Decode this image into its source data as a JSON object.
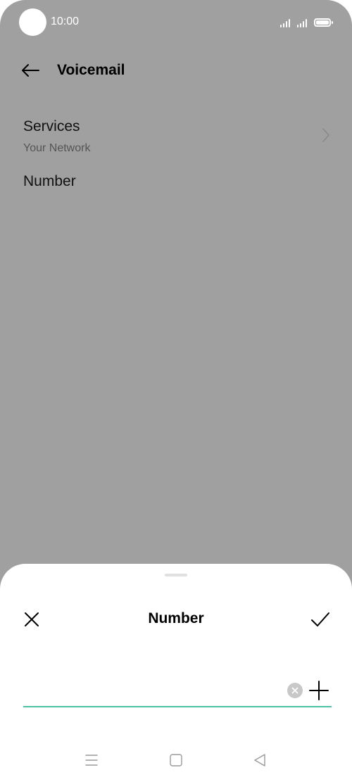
{
  "status_bar": {
    "time": "10:00",
    "icons": [
      "signal-icon",
      "signal-icon",
      "battery-icon"
    ]
  },
  "app_bar": {
    "back_icon": "arrow-left-icon",
    "title": "Voicemail"
  },
  "settings": {
    "items": [
      {
        "title": "Services",
        "subtitle": "Your Network",
        "icon": "chevron-right-icon"
      },
      {
        "title": "Number"
      }
    ]
  },
  "sheet": {
    "title": "Number",
    "close_icon": "close-icon",
    "confirm_icon": "checkmark-icon",
    "input": {
      "value": "",
      "placeholder": ""
    },
    "clear_icon": "clear-circle-icon",
    "add_icon": "plus-icon"
  },
  "nav_bar": {
    "icons": [
      "menu-icon",
      "home-icon",
      "back-triangle-icon"
    ]
  },
  "colors": {
    "scrim": "#a0a0a0",
    "accent": "#4cc2a4",
    "sheet": "#ffffff"
  }
}
